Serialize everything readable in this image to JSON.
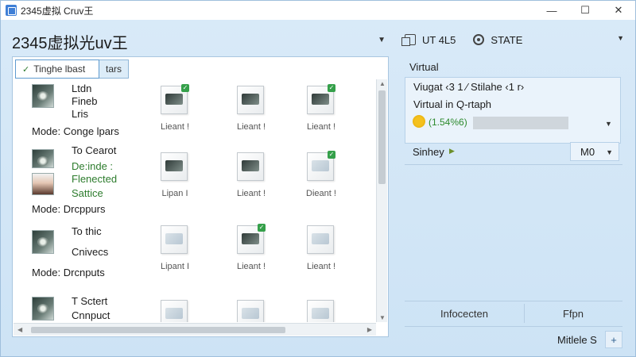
{
  "window": {
    "title": "2345虚拟 Cruv王",
    "controls": {
      "minimize": "—",
      "maximize": "☐",
      "close": "✕"
    }
  },
  "left": {
    "heading": "2345虚拟光uv王",
    "dropdown_icon": "chevron-down-icon",
    "tabs": [
      {
        "label": "Tinghe lbast",
        "checked": true
      },
      {
        "label": "tars"
      }
    ],
    "entries": [
      {
        "lines": [
          {
            "text": "Ltdn",
            "green": false
          },
          {
            "text": "Fineb",
            "green": false
          },
          {
            "text": "Lris",
            "green": false
          }
        ],
        "mode": "Mode:  Conge lpars"
      },
      {
        "lines": [
          {
            "text": "To Cearot",
            "green": false
          },
          {
            "text": "De:inde :",
            "green": true
          },
          {
            "text": "Flenected",
            "green": true
          },
          {
            "text": "Sattice",
            "green": true
          }
        ],
        "mode": "Mode:  Drcppurs"
      },
      {
        "lines": [
          {
            "text": "To thic",
            "green": false
          },
          {
            "text": "Cnivecs",
            "green": false
          }
        ],
        "mode": "Mode:  Drcnputs"
      },
      {
        "lines": [
          {
            "text": "T Sctert",
            "green": false
          },
          {
            "text": "Cnnpuct",
            "green": false
          }
        ],
        "mode": ""
      }
    ],
    "grid": [
      [
        "Lieant !",
        "Lieant !",
        "Lieant !"
      ],
      [
        "Lipan I",
        "Lieant !",
        "Dieant !"
      ],
      [
        "Lipant I",
        "Lieant !",
        "Lieant !"
      ],
      [
        "",
        "",
        ""
      ]
    ]
  },
  "right": {
    "top": {
      "label1": "UT  4L5",
      "label2": "STATE"
    },
    "panel_title": "Virtual",
    "line1": "Viugat ‹3 1 ⁄  Stilahe ‹1 r›",
    "line2": "Virtual in Q-rtaph",
    "status_green": "(1.54%6)",
    "sync_label": "Sinhey",
    "mode_select": "M0",
    "bottom_left": "Infocecten",
    "bottom_right": "Ffpn",
    "footer": "Mitlele S",
    "plus": "+"
  },
  "colors": {
    "accent": "#3f7fd6",
    "panel_bg": "#d3e6f6",
    "green": "#2d8a2d"
  }
}
